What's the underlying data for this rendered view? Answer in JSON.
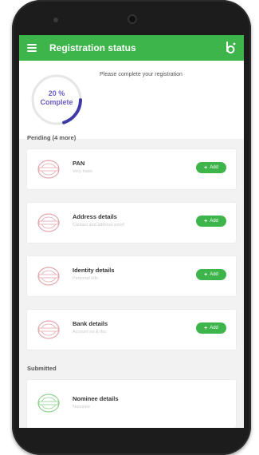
{
  "appbar": {
    "title": "Registration status"
  },
  "progress": {
    "percent_text": "20 %",
    "complete_text": "Complete",
    "fraction": 0.2
  },
  "header": {
    "message": "Please complete your registration"
  },
  "pending": {
    "label": "Pending (4 more)",
    "items": [
      {
        "title": "PAN",
        "subtitle": "Very basic",
        "button": "Add"
      },
      {
        "title": "Address details",
        "subtitle": "Contact and address proof",
        "button": "Add"
      },
      {
        "title": "Identity details",
        "subtitle": "Personal info",
        "button": "Add"
      },
      {
        "title": "Bank details",
        "subtitle": "Account no & ifsc",
        "button": "Add"
      }
    ]
  },
  "submitted": {
    "label": "Submitted",
    "items": [
      {
        "title": "Nominee details",
        "subtitle": "Nominee"
      }
    ]
  },
  "colors": {
    "accent": "#3db54a",
    "progress": "#3f3aa8",
    "progress_text": "#6a5cc8",
    "stamp_pending": "#e3a7ae",
    "stamp_done": "#8fd18f"
  }
}
